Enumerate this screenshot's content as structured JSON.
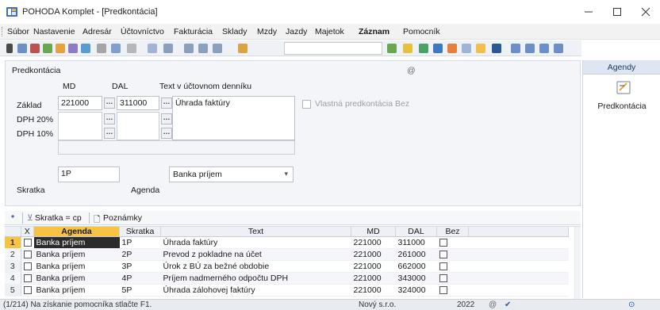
{
  "titlebar": {
    "title": "POHODA Komplet - [Predkontácia]"
  },
  "menu": [
    "Súbor",
    "Nastavenie",
    "Adresár",
    "Účtovníctvo",
    "Fakturácia",
    "Sklady",
    "Mzdy",
    "Jazdy",
    "Majetok",
    "Záznam",
    "Pomocník"
  ],
  "form": {
    "title": "Predkontácia",
    "col_md": "MD",
    "col_dal": "DAL",
    "col_text": "Text v účtovnom denníku",
    "row_zaklad": "Základ",
    "row_dph20": "DPH 20%",
    "row_dph10": "DPH 10%",
    "zaklad_md": "221000",
    "zaklad_dal": "311000",
    "zaklad_text": "Úhrada faktúry",
    "vlastna_label": "Vlastná predkontácia Bez",
    "skratka_label": "Skratka",
    "skratka_value": "1P",
    "agenda_label": "Agenda",
    "agenda_value": "Banka príjem"
  },
  "agendy": {
    "header": "Agendy",
    "item": "Predkontácia"
  },
  "filter": {
    "star": "*",
    "filter_text": "Skratka = cp",
    "notes": "Poznámky"
  },
  "table": {
    "headers": [
      "X",
      "Agenda",
      "Skratka",
      "Text",
      "MD",
      "DAL",
      "Bez"
    ],
    "rows": [
      {
        "num": "1",
        "agenda": "Banka príjem",
        "skratka": "1P",
        "text": "Úhrada faktúry",
        "md": "221000",
        "dal": "311000"
      },
      {
        "num": "2",
        "agenda": "Banka príjem",
        "skratka": "2P",
        "text": "Prevod z pokladne na účet",
        "md": "221000",
        "dal": "261000"
      },
      {
        "num": "3",
        "agenda": "Banka príjem",
        "skratka": "3P",
        "text": "Úrok z BÚ za bežné obdobie",
        "md": "221000",
        "dal": "662000"
      },
      {
        "num": "4",
        "agenda": "Banka príjem",
        "skratka": "4P",
        "text": "Príjem nadmerného odpočtu DPH",
        "md": "221000",
        "dal": "343000"
      },
      {
        "num": "5",
        "agenda": "Banka príjem",
        "skratka": "5P",
        "text": "Úhrada zálohovej faktúry",
        "md": "221000",
        "dal": "324000"
      }
    ]
  },
  "status": {
    "help": "(1/214) Na získanie pomocníka stlačte F1.",
    "company": "Nový s.r.o.",
    "year": "2022"
  },
  "colors": {
    "accent": "#2b5797",
    "selected_row": "#2b2b2b",
    "row_marker": "#f6c342"
  }
}
